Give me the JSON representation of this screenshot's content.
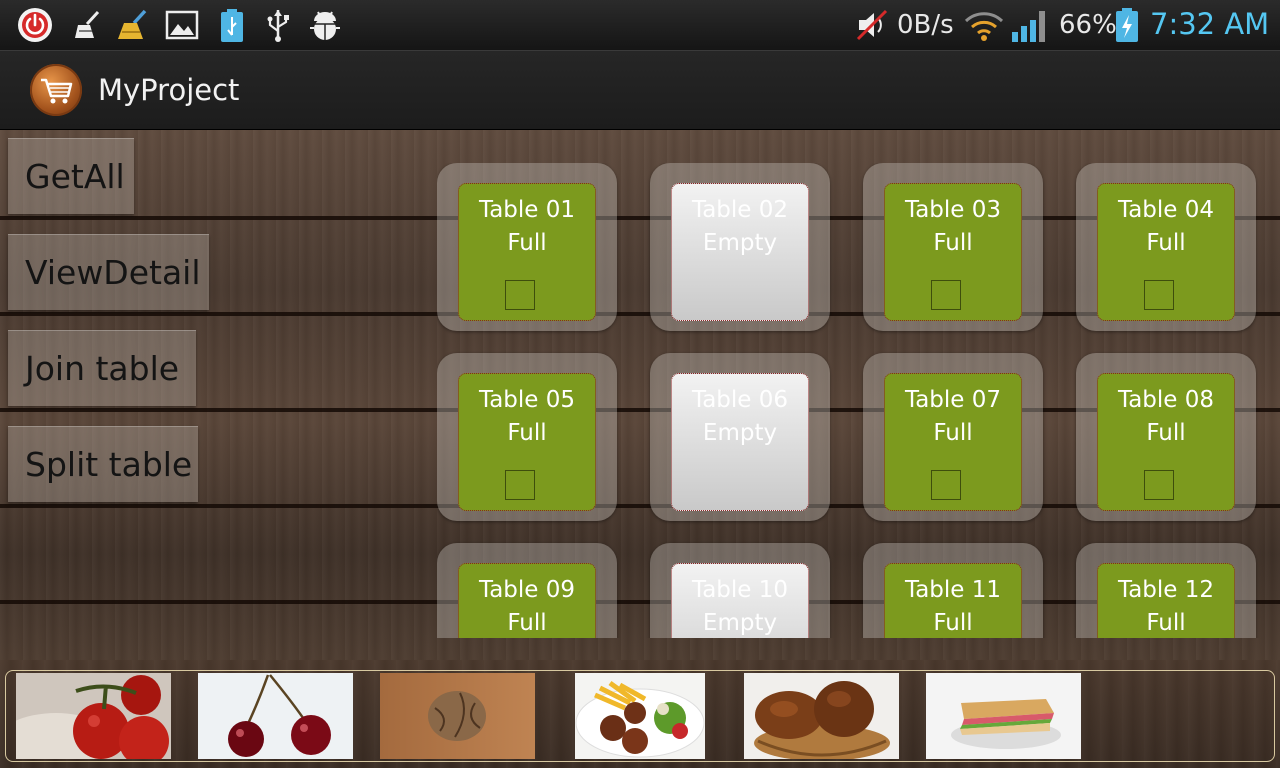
{
  "status_bar": {
    "icons": [
      "power-icon",
      "broom-icon",
      "cleaner-icon",
      "gallery-icon",
      "battery-usb-icon",
      "usb-icon",
      "android-debug-icon"
    ],
    "network_speed": "0B/s",
    "battery_percent": "66%",
    "clock": "7:32 AM",
    "colors": {
      "clock": "#55c7f2",
      "power": "#d62a2a"
    }
  },
  "action_bar": {
    "title": "MyProject",
    "logo_icon": "shopping-cart-icon"
  },
  "sidebar": {
    "buttons": [
      {
        "label": "GetAll"
      },
      {
        "label": "ViewDetail"
      },
      {
        "label": "Join table"
      },
      {
        "label": "Split table"
      }
    ]
  },
  "tables": [
    {
      "name": "Table 01",
      "status": "Full"
    },
    {
      "name": "Table 02",
      "status": "Empty"
    },
    {
      "name": "Table 03",
      "status": "Full"
    },
    {
      "name": "Table 04",
      "status": "Full"
    },
    {
      "name": "Table 05",
      "status": "Full"
    },
    {
      "name": "Table 06",
      "status": "Empty"
    },
    {
      "name": "Table 07",
      "status": "Full"
    },
    {
      "name": "Table 08",
      "status": "Full"
    },
    {
      "name": "Table 09",
      "status": "Full"
    },
    {
      "name": "Table 10",
      "status": "Empty"
    },
    {
      "name": "Table 11",
      "status": "Full"
    },
    {
      "name": "Table 12",
      "status": "Full"
    }
  ],
  "colors": {
    "full": "#7c9a1e",
    "empty": "#dedede"
  },
  "food_items": [
    {
      "icon": "tomatoes-image"
    },
    {
      "icon": "cherries-image"
    },
    {
      "icon": "walnut-image"
    },
    {
      "icon": "meatballs-fries-salad-image"
    },
    {
      "icon": "bread-basket-image"
    },
    {
      "icon": "sandwich-image"
    }
  ]
}
